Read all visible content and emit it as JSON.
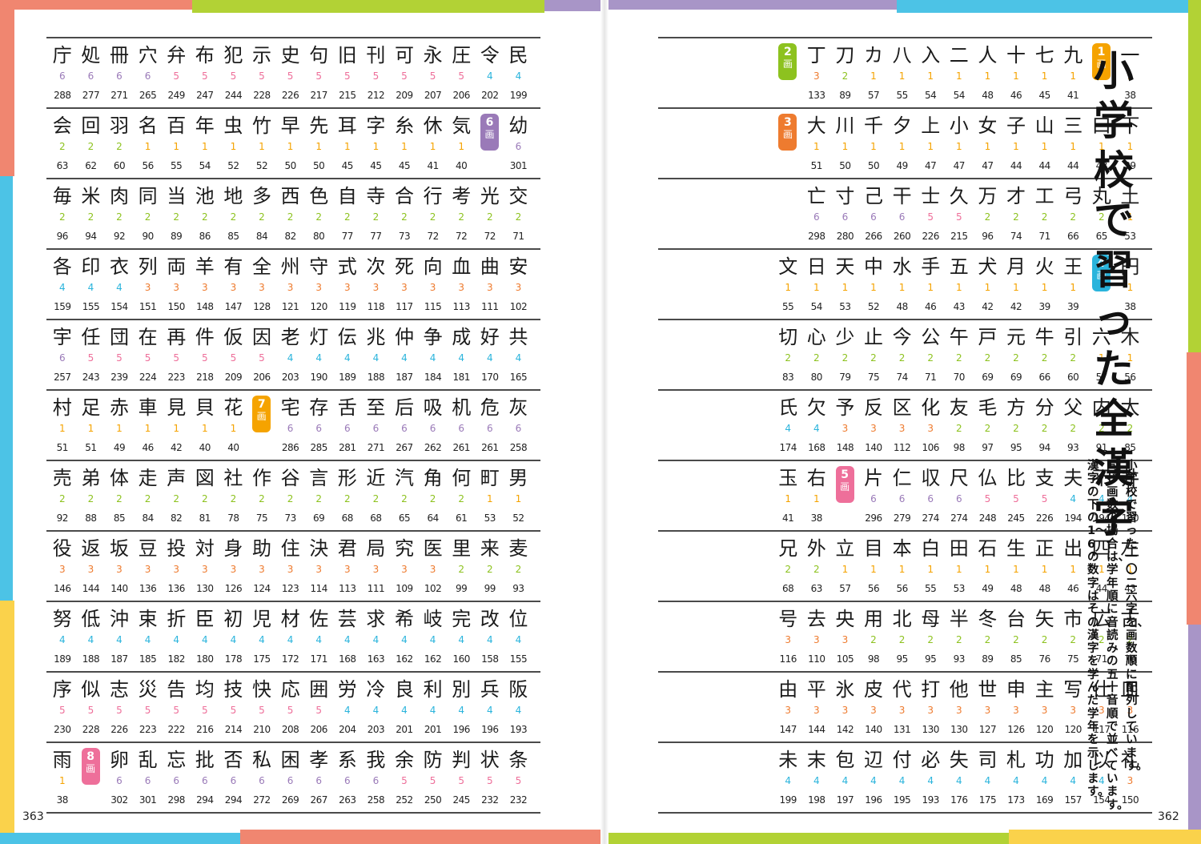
{
  "colors": {
    "grade1": "#f5a300",
    "grade2": "#8dc21f",
    "grade3": "#ee7b2f",
    "grade4": "#2ab4dc",
    "grade5": "#ee6f9a",
    "grade6": "#9a7ab8"
  },
  "page_numbers": {
    "left": "363",
    "right": "362"
  },
  "title": [
    "小",
    "学",
    "校",
    "で",
    "習",
    "っ",
    "た",
    "全",
    "漢",
    "字"
  ],
  "description": [
    "小学校で習った一〇二六字を、画数順に配列しています。",
    "同じ画数の場合は、学年順に音読みの五十音順で並べています。",
    "漢字の下の1〜6の数字はその漢字を学んだ学年を示します。"
  ],
  "right_rows": [
    [
      [
        "一",
        "1",
        "38"
      ],
      [
        "M",
        "1"
      ],
      [
        "九",
        "1",
        "41"
      ],
      [
        "七",
        "1",
        "45"
      ],
      [
        "十",
        "1",
        "46"
      ],
      [
        "人",
        "1",
        "48"
      ],
      [
        "二",
        "1",
        "54"
      ],
      [
        "入",
        "1",
        "54"
      ],
      [
        "八",
        "1",
        "55"
      ],
      [
        "カ",
        "1",
        "57"
      ],
      [
        "刀",
        "2",
        "89"
      ],
      [
        "丁",
        "3",
        "133"
      ],
      [
        "M",
        "2"
      ]
    ],
    [
      [
        "下",
        "1",
        "39"
      ],
      [
        "口",
        "1",
        "43"
      ],
      [
        "三",
        "1",
        "44"
      ],
      [
        "山",
        "1",
        "44"
      ],
      [
        "子",
        "1",
        "44"
      ],
      [
        "女",
        "1",
        "47"
      ],
      [
        "小",
        "1",
        "47"
      ],
      [
        "上",
        "1",
        "47"
      ],
      [
        "夕",
        "1",
        "49"
      ],
      [
        "千",
        "1",
        "50"
      ],
      [
        "川",
        "1",
        "50"
      ],
      [
        "大",
        "1",
        "51"
      ],
      [
        "M",
        "3"
      ]
    ],
    [
      [
        "土",
        "1",
        "53"
      ],
      [
        "丸",
        "2",
        "65"
      ],
      [
        "弓",
        "2",
        "66"
      ],
      [
        "工",
        "2",
        "71"
      ],
      [
        "才",
        "2",
        "74"
      ],
      [
        "万",
        "2",
        "96"
      ],
      [
        "久",
        "5",
        "215"
      ],
      [
        "士",
        "5",
        "226"
      ],
      [
        "干",
        "6",
        "260"
      ],
      [
        "己",
        "6",
        "266"
      ],
      [
        "寸",
        "6",
        "280"
      ],
      [
        "亡",
        "6",
        "298"
      ],
      [
        "E"
      ]
    ],
    [
      [
        "円",
        "1",
        "38"
      ],
      [
        "M",
        "4"
      ],
      [
        "王",
        "1",
        "39"
      ],
      [
        "火",
        "1",
        "39"
      ],
      [
        "月",
        "1",
        "42"
      ],
      [
        "犬",
        "1",
        "42"
      ],
      [
        "五",
        "1",
        "43"
      ],
      [
        "手",
        "1",
        "46"
      ],
      [
        "水",
        "1",
        "48"
      ],
      [
        "中",
        "1",
        "52"
      ],
      [
        "天",
        "1",
        "53"
      ],
      [
        "日",
        "1",
        "54"
      ],
      [
        "文",
        "1",
        "55"
      ]
    ],
    [
      [
        "木",
        "1",
        "56"
      ],
      [
        "六",
        "1",
        "57"
      ],
      [
        "引",
        "2",
        "60"
      ],
      [
        "牛",
        "2",
        "66"
      ],
      [
        "元",
        "2",
        "69"
      ],
      [
        "戸",
        "2",
        "69"
      ],
      [
        "午",
        "2",
        "70"
      ],
      [
        "公",
        "2",
        "71"
      ],
      [
        "今",
        "2",
        "74"
      ],
      [
        "止",
        "2",
        "75"
      ],
      [
        "少",
        "2",
        "79"
      ],
      [
        "心",
        "2",
        "80"
      ],
      [
        "切",
        "2",
        "83"
      ]
    ],
    [
      [
        "太",
        "2",
        "85"
      ],
      [
        "内",
        "2",
        "91"
      ],
      [
        "父",
        "2",
        "93"
      ],
      [
        "分",
        "2",
        "94"
      ],
      [
        "方",
        "2",
        "95"
      ],
      [
        "毛",
        "2",
        "97"
      ],
      [
        "友",
        "2",
        "98"
      ],
      [
        "化",
        "3",
        "106"
      ],
      [
        "区",
        "3",
        "112"
      ],
      [
        "反",
        "3",
        "140"
      ],
      [
        "予",
        "3",
        "148"
      ],
      [
        "欠",
        "4",
        "168"
      ],
      [
        "氏",
        "4",
        "174"
      ]
    ],
    [
      [
        "井",
        "4",
        "180"
      ],
      [
        "不",
        "4",
        "194"
      ],
      [
        "夫",
        "4",
        "194"
      ],
      [
        "支",
        "5",
        "226"
      ],
      [
        "比",
        "5",
        "245"
      ],
      [
        "仏",
        "5",
        "248"
      ],
      [
        "尺",
        "6",
        "274"
      ],
      [
        "収",
        "6",
        "274"
      ],
      [
        "仁",
        "6",
        "279"
      ],
      [
        "片",
        "6",
        "296"
      ],
      [
        "M",
        "5"
      ],
      [
        "右",
        "1",
        "38"
      ],
      [
        "玉",
        "1",
        "41"
      ]
    ],
    [
      [
        "左",
        "1",
        "43"
      ],
      [
        "四",
        "1",
        "44"
      ],
      [
        "出",
        "1",
        "46"
      ],
      [
        "正",
        "1",
        "48"
      ],
      [
        "生",
        "1",
        "48"
      ],
      [
        "石",
        "1",
        "49"
      ],
      [
        "田",
        "1",
        "53"
      ],
      [
        "白",
        "1",
        "55"
      ],
      [
        "本",
        "1",
        "56"
      ],
      [
        "目",
        "1",
        "56"
      ],
      [
        "立",
        "1",
        "57"
      ],
      [
        "外",
        "2",
        "63"
      ],
      [
        "兄",
        "2",
        "68"
      ]
    ],
    [
      [
        "古",
        "2",
        "70"
      ],
      [
        "広",
        "2",
        "71"
      ],
      [
        "市",
        "2",
        "75"
      ],
      [
        "矢",
        "2",
        "76"
      ],
      [
        "台",
        "2",
        "85"
      ],
      [
        "冬",
        "2",
        "89"
      ],
      [
        "半",
        "2",
        "93"
      ],
      [
        "母",
        "2",
        "95"
      ],
      [
        "北",
        "2",
        "95"
      ],
      [
        "用",
        "2",
        "98"
      ],
      [
        "央",
        "3",
        "105"
      ],
      [
        "去",
        "3",
        "110"
      ],
      [
        "号",
        "3",
        "116"
      ]
    ],
    [
      [
        "皿",
        "3",
        "116"
      ],
      [
        "仕",
        "3",
        "117"
      ],
      [
        "写",
        "3",
        "120"
      ],
      [
        "主",
        "3",
        "120"
      ],
      [
        "申",
        "3",
        "126"
      ],
      [
        "世",
        "3",
        "127"
      ],
      [
        "他",
        "3",
        "130"
      ],
      [
        "打",
        "3",
        "130"
      ],
      [
        "代",
        "3",
        "131"
      ],
      [
        "皮",
        "3",
        "140"
      ],
      [
        "氷",
        "3",
        "142"
      ],
      [
        "平",
        "3",
        "144"
      ],
      [
        "由",
        "3",
        "147"
      ]
    ],
    [
      [
        "礼",
        "3",
        "150"
      ],
      [
        "以",
        "4",
        "154"
      ],
      [
        "加",
        "4",
        "157"
      ],
      [
        "功",
        "4",
        "169"
      ],
      [
        "札",
        "4",
        "173"
      ],
      [
        "司",
        "4",
        "175"
      ],
      [
        "失",
        "4",
        "176"
      ],
      [
        "必",
        "4",
        "193"
      ],
      [
        "付",
        "4",
        "195"
      ],
      [
        "辺",
        "4",
        "196"
      ],
      [
        "包",
        "4",
        "197"
      ],
      [
        "末",
        "4",
        "198"
      ],
      [
        "未",
        "4",
        "199"
      ]
    ]
  ],
  "left_rows": [
    [
      [
        "民",
        "4",
        "199"
      ],
      [
        "令",
        "4",
        "202"
      ],
      [
        "圧",
        "5",
        "206"
      ],
      [
        "永",
        "5",
        "207"
      ],
      [
        "可",
        "5",
        "209"
      ],
      [
        "刊",
        "5",
        "212"
      ],
      [
        "旧",
        "5",
        "215"
      ],
      [
        "句",
        "5",
        "217"
      ],
      [
        "史",
        "5",
        "226"
      ],
      [
        "示",
        "5",
        "228"
      ],
      [
        "犯",
        "5",
        "244"
      ],
      [
        "布",
        "5",
        "247"
      ],
      [
        "弁",
        "5",
        "249"
      ],
      [
        "穴",
        "6",
        "265"
      ],
      [
        "冊",
        "6",
        "271"
      ],
      [
        "処",
        "6",
        "277"
      ],
      [
        "庁",
        "6",
        "288"
      ]
    ],
    [
      [
        "幼",
        "6",
        "301"
      ],
      [
        "M",
        "6"
      ],
      [
        "気",
        "1",
        "40"
      ],
      [
        "休",
        "1",
        "41"
      ],
      [
        "糸",
        "1",
        "45"
      ],
      [
        "字",
        "1",
        "45"
      ],
      [
        "耳",
        "1",
        "45"
      ],
      [
        "先",
        "1",
        "50"
      ],
      [
        "早",
        "1",
        "50"
      ],
      [
        "竹",
        "1",
        "52"
      ],
      [
        "虫",
        "1",
        "52"
      ],
      [
        "年",
        "1",
        "54"
      ],
      [
        "百",
        "1",
        "55"
      ],
      [
        "名",
        "1",
        "56"
      ],
      [
        "羽",
        "2",
        "60"
      ],
      [
        "回",
        "2",
        "62"
      ],
      [
        "会",
        "2",
        "63"
      ]
    ],
    [
      [
        "交",
        "2",
        "71"
      ],
      [
        "光",
        "2",
        "72"
      ],
      [
        "考",
        "2",
        "72"
      ],
      [
        "行",
        "2",
        "72"
      ],
      [
        "合",
        "2",
        "73"
      ],
      [
        "寺",
        "2",
        "77"
      ],
      [
        "自",
        "2",
        "77"
      ],
      [
        "色",
        "2",
        "80"
      ],
      [
        "西",
        "2",
        "82"
      ],
      [
        "多",
        "2",
        "84"
      ],
      [
        "地",
        "2",
        "85"
      ],
      [
        "池",
        "2",
        "86"
      ],
      [
        "当",
        "2",
        "89"
      ],
      [
        "同",
        "2",
        "90"
      ],
      [
        "肉",
        "2",
        "92"
      ],
      [
        "米",
        "2",
        "94"
      ],
      [
        "毎",
        "2",
        "96"
      ]
    ],
    [
      [
        "安",
        "3",
        "102"
      ],
      [
        "曲",
        "3",
        "111"
      ],
      [
        "血",
        "3",
        "113"
      ],
      [
        "向",
        "3",
        "115"
      ],
      [
        "死",
        "3",
        "117"
      ],
      [
        "次",
        "3",
        "118"
      ],
      [
        "式",
        "3",
        "119"
      ],
      [
        "守",
        "3",
        "120"
      ],
      [
        "州",
        "3",
        "121"
      ],
      [
        "全",
        "3",
        "128"
      ],
      [
        "有",
        "3",
        "147"
      ],
      [
        "羊",
        "3",
        "148"
      ],
      [
        "両",
        "3",
        "150"
      ],
      [
        "列",
        "3",
        "151"
      ],
      [
        "衣",
        "4",
        "154"
      ],
      [
        "印",
        "4",
        "155"
      ],
      [
        "各",
        "4",
        "159"
      ]
    ],
    [
      [
        "共",
        "4",
        "165"
      ],
      [
        "好",
        "4",
        "170"
      ],
      [
        "成",
        "4",
        "181"
      ],
      [
        "争",
        "4",
        "184"
      ],
      [
        "仲",
        "4",
        "187"
      ],
      [
        "兆",
        "4",
        "188"
      ],
      [
        "伝",
        "4",
        "189"
      ],
      [
        "灯",
        "4",
        "190"
      ],
      [
        "老",
        "4",
        "203"
      ],
      [
        "因",
        "5",
        "206"
      ],
      [
        "仮",
        "5",
        "209"
      ],
      [
        "件",
        "5",
        "218"
      ],
      [
        "再",
        "5",
        "223"
      ],
      [
        "在",
        "5",
        "224"
      ],
      [
        "団",
        "5",
        "239"
      ],
      [
        "任",
        "5",
        "243"
      ],
      [
        "宇",
        "6",
        "257"
      ]
    ],
    [
      [
        "灰",
        "6",
        "258"
      ],
      [
        "危",
        "6",
        "261"
      ],
      [
        "机",
        "6",
        "261"
      ],
      [
        "吸",
        "6",
        "262"
      ],
      [
        "后",
        "6",
        "267"
      ],
      [
        "至",
        "6",
        "271"
      ],
      [
        "舌",
        "6",
        "281"
      ],
      [
        "存",
        "6",
        "285"
      ],
      [
        "宅",
        "6",
        "286"
      ],
      [
        "M",
        "7"
      ],
      [
        "花",
        "1",
        "40"
      ],
      [
        "貝",
        "1",
        "40"
      ],
      [
        "見",
        "1",
        "42"
      ],
      [
        "車",
        "1",
        "46"
      ],
      [
        "赤",
        "1",
        "49"
      ],
      [
        "足",
        "1",
        "51"
      ],
      [
        "村",
        "1",
        "51"
      ]
    ],
    [
      [
        "男",
        "1",
        "52"
      ],
      [
        "町",
        "1",
        "53"
      ],
      [
        "何",
        "2",
        "61"
      ],
      [
        "角",
        "2",
        "64"
      ],
      [
        "汽",
        "2",
        "65"
      ],
      [
        "近",
        "2",
        "68"
      ],
      [
        "形",
        "2",
        "68"
      ],
      [
        "言",
        "2",
        "69"
      ],
      [
        "谷",
        "2",
        "73"
      ],
      [
        "作",
        "2",
        "75"
      ],
      [
        "社",
        "2",
        "78"
      ],
      [
        "図",
        "2",
        "81"
      ],
      [
        "声",
        "2",
        "82"
      ],
      [
        "走",
        "2",
        "84"
      ],
      [
        "体",
        "2",
        "85"
      ],
      [
        "弟",
        "2",
        "88"
      ],
      [
        "売",
        "2",
        "92"
      ]
    ],
    [
      [
        "麦",
        "2",
        "93"
      ],
      [
        "来",
        "2",
        "99"
      ],
      [
        "里",
        "2",
        "99"
      ],
      [
        "医",
        "3",
        "102"
      ],
      [
        "究",
        "3",
        "109"
      ],
      [
        "局",
        "3",
        "111"
      ],
      [
        "君",
        "3",
        "113"
      ],
      [
        "決",
        "3",
        "114"
      ],
      [
        "住",
        "3",
        "123"
      ],
      [
        "助",
        "3",
        "124"
      ],
      [
        "身",
        "3",
        "126"
      ],
      [
        "対",
        "3",
        "130"
      ],
      [
        "投",
        "3",
        "136"
      ],
      [
        "豆",
        "3",
        "136"
      ],
      [
        "坂",
        "3",
        "140"
      ],
      [
        "返",
        "3",
        "144"
      ],
      [
        "役",
        "3",
        "146"
      ]
    ],
    [
      [
        "位",
        "4",
        "155"
      ],
      [
        "改",
        "4",
        "158"
      ],
      [
        "完",
        "4",
        "160"
      ],
      [
        "岐",
        "4",
        "162"
      ],
      [
        "希",
        "4",
        "162"
      ],
      [
        "求",
        "4",
        "163"
      ],
      [
        "芸",
        "4",
        "168"
      ],
      [
        "佐",
        "4",
        "171"
      ],
      [
        "材",
        "4",
        "172"
      ],
      [
        "児",
        "4",
        "175"
      ],
      [
        "初",
        "4",
        "178"
      ],
      [
        "臣",
        "4",
        "180"
      ],
      [
        "折",
        "4",
        "182"
      ],
      [
        "束",
        "4",
        "185"
      ],
      [
        "沖",
        "4",
        "187"
      ],
      [
        "低",
        "4",
        "188"
      ],
      [
        "努",
        "4",
        "189"
      ]
    ],
    [
      [
        "阪",
        "4",
        "193"
      ],
      [
        "兵",
        "4",
        "196"
      ],
      [
        "別",
        "4",
        "196"
      ],
      [
        "利",
        "4",
        "201"
      ],
      [
        "良",
        "4",
        "201"
      ],
      [
        "冷",
        "4",
        "203"
      ],
      [
        "労",
        "4",
        "204"
      ],
      [
        "囲",
        "5",
        "206"
      ],
      [
        "応",
        "5",
        "208"
      ],
      [
        "快",
        "5",
        "210"
      ],
      [
        "技",
        "5",
        "214"
      ],
      [
        "均",
        "5",
        "216"
      ],
      [
        "告",
        "5",
        "222"
      ],
      [
        "災",
        "5",
        "223"
      ],
      [
        "志",
        "5",
        "226"
      ],
      [
        "似",
        "5",
        "228"
      ],
      [
        "序",
        "5",
        "230"
      ]
    ],
    [
      [
        "条",
        "5",
        "232"
      ],
      [
        "状",
        "5",
        "232"
      ],
      [
        "判",
        "5",
        "245"
      ],
      [
        "防",
        "5",
        "250"
      ],
      [
        "余",
        "5",
        "252"
      ],
      [
        "我",
        "6",
        "258"
      ],
      [
        "系",
        "6",
        "263"
      ],
      [
        "孝",
        "6",
        "267"
      ],
      [
        "困",
        "6",
        "269"
      ],
      [
        "私",
        "6",
        "272"
      ],
      [
        "否",
        "6",
        "294"
      ],
      [
        "批",
        "6",
        "294"
      ],
      [
        "忘",
        "6",
        "298"
      ],
      [
        "乱",
        "6",
        "301"
      ],
      [
        "卵",
        "6",
        "302"
      ],
      [
        "M",
        "8"
      ],
      [
        "雨",
        "1",
        "38"
      ]
    ]
  ],
  "marker_suffix": "画"
}
